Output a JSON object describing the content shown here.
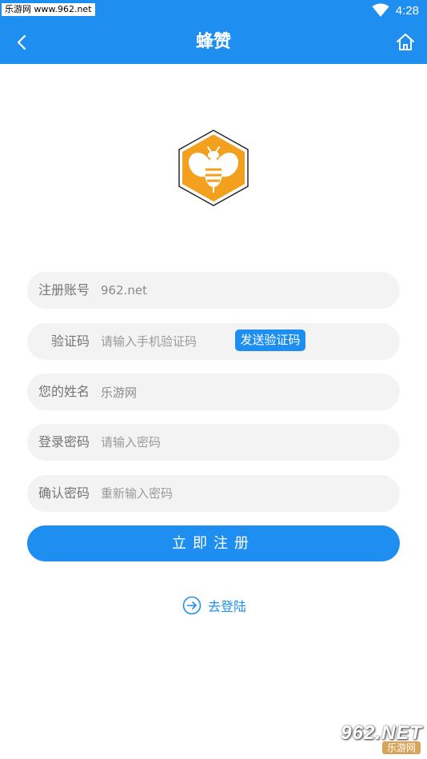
{
  "status_bar": {
    "watermark_tag": "乐游网 www.962.net",
    "time": "4:28",
    "wifi_icon": "wifi-icon"
  },
  "app_bar": {
    "title": "蜂赞",
    "back_icon": "chevron-left-icon",
    "home_icon": "home-icon",
    "color": "#1E8FF0"
  },
  "logo": {
    "icon": "bee-hexagon-logo",
    "color": "#F2A01D"
  },
  "form": {
    "account": {
      "label": "注册账号",
      "value": "962.net",
      "placeholder": ""
    },
    "code": {
      "label": "验证码",
      "value": "",
      "placeholder": "请输入手机验证码",
      "send_button": "发送验证码"
    },
    "name": {
      "label": "您的姓名",
      "value": "乐游网",
      "placeholder": ""
    },
    "password": {
      "label": "登录密码",
      "value": "",
      "placeholder": "请输入密码"
    },
    "confirm": {
      "label": "确认密码",
      "value": "",
      "placeholder": "重新输入密码"
    }
  },
  "register_button": "立即注册",
  "login_link": {
    "text": "去登陆",
    "icon": "arrow-right-circle-icon"
  },
  "watermark": {
    "main": "962.NET",
    "sub": "乐游网"
  }
}
